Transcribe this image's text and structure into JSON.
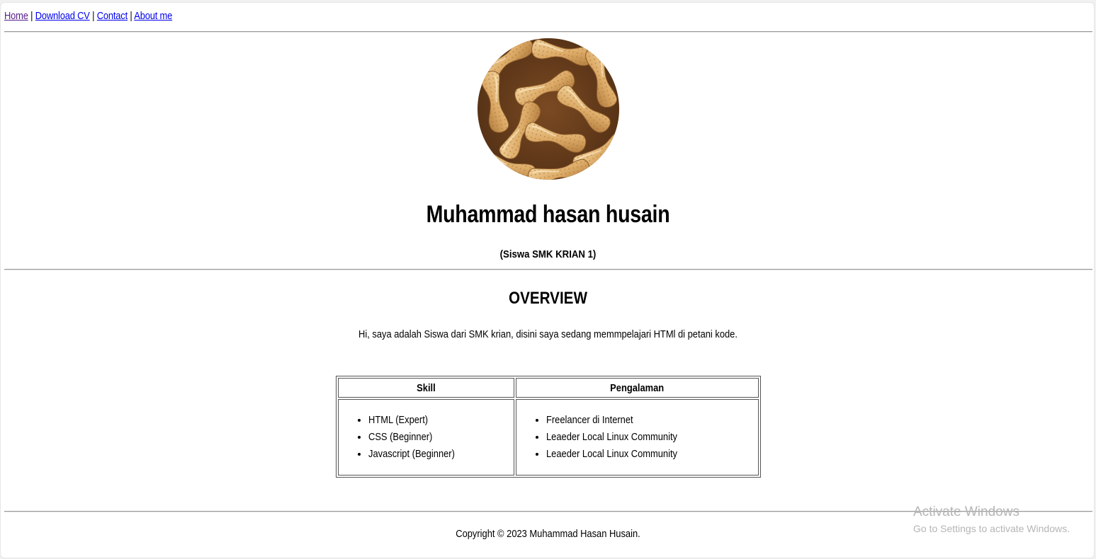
{
  "nav": {
    "links": [
      "Home",
      "Download CV",
      "Contact",
      "About me"
    ],
    "separator": "|"
  },
  "profile": {
    "photo_icon": "peanuts-photo",
    "name": "Muhammad hasan husain",
    "subtitle": "(Siswa SMK KRIAN 1)"
  },
  "overview": {
    "heading": "OVERVIEW",
    "text": "Hi, saya adalah Siswa dari SMK krian, disini saya sedang memmpelajari HTMl di petani kode."
  },
  "table": {
    "headers": [
      "Skill",
      "Pengalaman"
    ],
    "skills": [
      "HTML (Expert)",
      "CSS (Beginner)",
      "Javascript (Beginner)"
    ],
    "experience": [
      "Freelancer di Internet",
      "Leaeder Local Linux Community",
      "Leaeder Local Linux Community"
    ]
  },
  "footer": {
    "copyright": "Copyright © 2023 Muhammad Hasan Husain."
  },
  "watermark": {
    "title": "Activate Windows",
    "subtitle": "Go to Settings to activate Windows."
  },
  "colors": {
    "link": "#0000ee",
    "visited_link": "#551a8b",
    "rule": "#9a9a9a",
    "watermark": "#b5b5b5"
  }
}
